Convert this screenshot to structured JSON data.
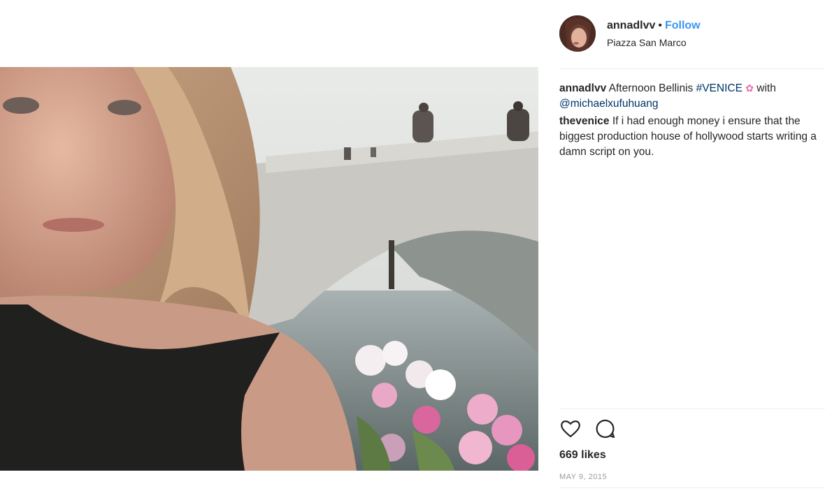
{
  "post": {
    "username": "annadlvv",
    "separator": "•",
    "follow_label": "Follow",
    "location": "Piazza San Marco",
    "likes": "669 likes",
    "date": "MAY 9, 2015"
  },
  "comments": [
    {
      "username": "annadlvv",
      "text_before": "Afternoon Bellinis",
      "hashtag": "#VENICE",
      "flower_glyph": "✿",
      "text_after": "with",
      "mention": "@michaelxufuhuang"
    },
    {
      "username": "thevenice",
      "text": "If i had enough money i ensure that the biggest production house of hollywood starts writing a damn script on you."
    }
  ],
  "icons": {
    "like": "heart-icon",
    "comment": "comment-bubble-icon"
  },
  "colors": {
    "link_blue": "#3897f0",
    "hashtag_navy": "#003569",
    "text": "#262626",
    "muted": "#999999"
  }
}
